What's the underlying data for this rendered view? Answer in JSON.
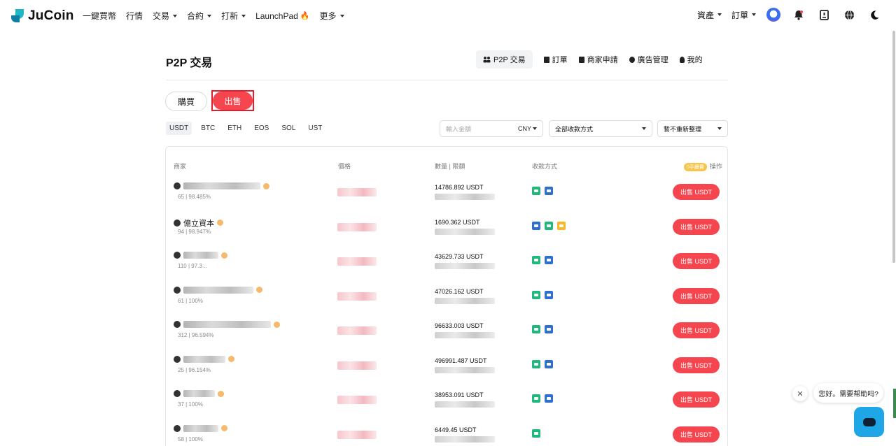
{
  "nav": {
    "logo": "JuCoin",
    "items": [
      {
        "label": "一鍵買幣",
        "caret": false
      },
      {
        "label": "行情",
        "caret": false
      },
      {
        "label": "交易",
        "caret": true
      },
      {
        "label": "合約",
        "caret": true
      },
      {
        "label": "打新",
        "caret": true
      },
      {
        "label": "LaunchPad",
        "caret": false,
        "fire": true
      },
      {
        "label": "更多",
        "caret": true
      }
    ],
    "right": [
      {
        "label": "資產",
        "caret": true
      },
      {
        "label": "訂單",
        "caret": true
      }
    ],
    "icons": [
      "avatar",
      "bell-icon",
      "download-icon",
      "globe-icon",
      "moon-icon"
    ]
  },
  "page": {
    "title": "P2P 交易",
    "subnav": [
      "P2P 交易",
      "訂單",
      "商家申請",
      "廣告管理",
      "我的"
    ],
    "toggle": {
      "buy": "購買",
      "sell": "出售",
      "selected": "sell"
    },
    "coins": [
      "USDT",
      "BTC",
      "ETH",
      "EOS",
      "SOL",
      "UST"
    ],
    "selected_coin": "USDT",
    "filters": {
      "amount_placeholder": "輸入金額",
      "currency": "CNY",
      "payment": "全部收款方式",
      "sort": "暫不重新整理"
    },
    "table_headers": {
      "merchant": "商家",
      "price": "價格",
      "qty": "數量 | 限額",
      "pay": "收款方式",
      "badge": "0手續費",
      "action": "操作"
    },
    "rows": [
      {
        "stats": "65 | 98.485%",
        "qty": "14786.892 USDT",
        "pays": [
          "green",
          "blue"
        ],
        "btn": "出售 USDT",
        "nameW": 110
      },
      {
        "name": "億立資本",
        "stats": "94 | 98.947%",
        "qty": "1690.362 USDT",
        "pays": [
          "blue",
          "green",
          "yellow"
        ],
        "btn": "出售 USDT",
        "nameW": 0
      },
      {
        "stats": "110 | 97.3...",
        "qty": "43629.733 USDT",
        "pays": [
          "green",
          "blue"
        ],
        "btn": "出售 USDT",
        "nameW": 50
      },
      {
        "stats": "61 | 100%",
        "qty": "47026.162 USDT",
        "pays": [
          "green",
          "blue"
        ],
        "btn": "出售 USDT",
        "nameW": 100
      },
      {
        "stats": "312 | 96.594%",
        "qty": "96633.003 USDT",
        "pays": [
          "green",
          "blue"
        ],
        "btn": "出售 USDT",
        "nameW": 125
      },
      {
        "stats": "25 | 96.154%",
        "qty": "496991.487 USDT",
        "pays": [
          "green",
          "blue"
        ],
        "btn": "出售 USDT",
        "nameW": 60
      },
      {
        "stats": "37 | 100%",
        "qty": "38953.091 USDT",
        "pays": [
          "green",
          "blue"
        ],
        "btn": "出售 USDT",
        "nameW": 45
      },
      {
        "stats": "58 | 100%",
        "qty": "6449.45 USDT",
        "pays": [
          "green"
        ],
        "btn": "出售 USDT",
        "nameW": 50
      }
    ]
  },
  "chat": {
    "close": "✕",
    "bubble": "您好。需要帮助吗?"
  }
}
